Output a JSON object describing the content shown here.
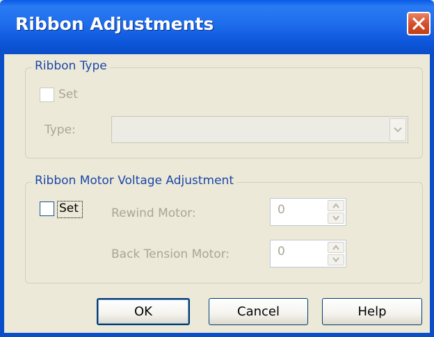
{
  "window": {
    "title": "Ribbon Adjustments"
  },
  "ribbon_type": {
    "legend": "Ribbon Type",
    "set_label": "Set",
    "set_checked": false,
    "type_label": "Type:",
    "type_value": ""
  },
  "voltage": {
    "legend": "Ribbon Motor Voltage Adjustment",
    "set_label": "Set",
    "set_checked": false,
    "rewind_label": "Rewind Motor:",
    "rewind_value": "0",
    "back_tension_label": "Back Tension Motor:",
    "back_tension_value": "0"
  },
  "buttons": {
    "ok": "OK",
    "cancel": "Cancel",
    "help": "Help"
  },
  "colors": {
    "titlebar": "#0a5ae8",
    "close": "#d5512b",
    "legend": "#1b47a8",
    "disabled_text": "#a7a695"
  }
}
